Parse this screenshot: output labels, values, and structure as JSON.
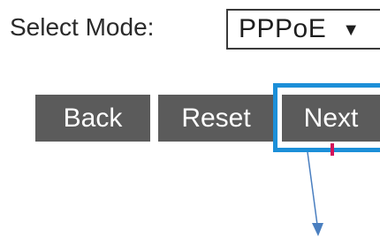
{
  "mode": {
    "label": "Select Mode:",
    "selected": "PPPoE",
    "caret_icon": "dropdown-caret-icon",
    "caret_glyph": "▼"
  },
  "buttons": {
    "back": "Back",
    "reset": "Reset",
    "next": "Next"
  },
  "annotations": {
    "highlight_color": "#1c8fd8",
    "arrow_color": "#4a7fc0",
    "marker_color": "#d4145a"
  },
  "colors": {
    "button_bg": "#5b5b5b",
    "button_text": "#ffffff"
  }
}
